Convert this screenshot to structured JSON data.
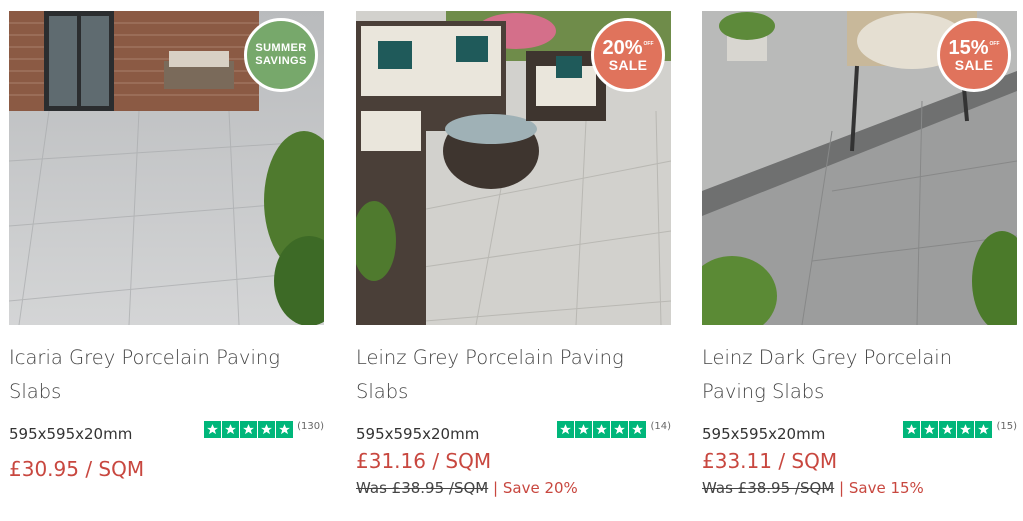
{
  "colors": {
    "price_red": "#c8473f",
    "trustpilot_green": "#00b67a",
    "badge_green": "#77a86b",
    "badge_salmon": "#e0735c"
  },
  "products": [
    {
      "title": "Icaria Grey Porcelain Paving Slabs",
      "badge": {
        "line1": "SUMMER",
        "line2": "SAVINGS"
      },
      "size": "595x595x20mm",
      "rating_stars": 5,
      "review_count": "(130)",
      "price": "£30.95 / SQM"
    },
    {
      "title": "Leinz Grey Porcelain Paving Slabs",
      "badge": {
        "pct": "20%",
        "off": "OFF",
        "sale": "SALE"
      },
      "size": "595x595x20mm",
      "rating_stars": 5,
      "review_count": "(14)",
      "price": "£31.16 / SQM",
      "was_price": "Was £38.95 /SQM",
      "separator": "|",
      "save": "Save 20%"
    },
    {
      "title": "Leinz Dark Grey Porcelain Paving Slabs",
      "badge": {
        "pct": "15%",
        "off": "OFF",
        "sale": "SALE"
      },
      "size": "595x595x20mm",
      "rating_stars": 5,
      "review_count": "(15)",
      "price": "£33.11 / SQM",
      "was_price": "Was £38.95 /SQM",
      "separator": "|",
      "save": "Save 15%"
    }
  ]
}
